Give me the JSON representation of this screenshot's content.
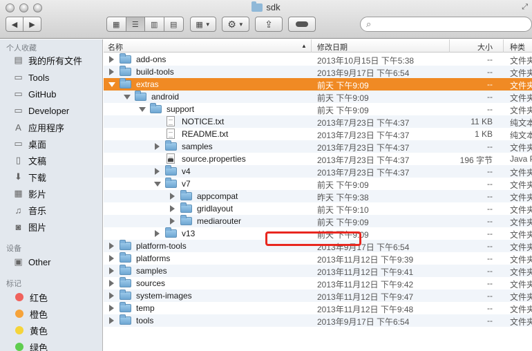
{
  "window": {
    "title": "sdk"
  },
  "sidebar": {
    "favorites_heading": "个人收藏",
    "favorites": [
      {
        "label": "我的所有文件",
        "icon": "all-files-icon"
      },
      {
        "label": "Tools",
        "icon": "folder-icon"
      },
      {
        "label": "GitHub",
        "icon": "folder-icon"
      },
      {
        "label": "Developer",
        "icon": "folder-icon"
      },
      {
        "label": "应用程序",
        "icon": "applications-icon"
      },
      {
        "label": "桌面",
        "icon": "desktop-icon"
      },
      {
        "label": "文稿",
        "icon": "documents-icon"
      },
      {
        "label": "下载",
        "icon": "downloads-icon"
      },
      {
        "label": "影片",
        "icon": "movies-icon"
      },
      {
        "label": "音乐",
        "icon": "music-icon"
      },
      {
        "label": "图片",
        "icon": "pictures-icon"
      }
    ],
    "devices_heading": "设备",
    "devices": [
      {
        "label": "Other",
        "icon": "disk-icon"
      }
    ],
    "tags_heading": "标记",
    "tags": [
      {
        "label": "红色",
        "color": "#f0625c"
      },
      {
        "label": "橙色",
        "color": "#f6a33a"
      },
      {
        "label": "黄色",
        "color": "#f5d43a"
      },
      {
        "label": "绿色",
        "color": "#5fcd4f"
      }
    ]
  },
  "columns": {
    "name": "名称",
    "date": "修改日期",
    "size": "大小",
    "kind": "种类"
  },
  "files": [
    {
      "name": "add-ons",
      "date": "2013年10月15日 下午5:38",
      "size": "--",
      "kind": "文件夹",
      "type": "folder",
      "depth": 0,
      "expanded": false
    },
    {
      "name": "build-tools",
      "date": "2013年9月17日 下午6:54",
      "size": "--",
      "kind": "文件夹",
      "type": "folder",
      "depth": 0,
      "expanded": false
    },
    {
      "name": "extras",
      "date": "前天 下午9:09",
      "size": "--",
      "kind": "文件夹",
      "type": "folder",
      "depth": 0,
      "expanded": true,
      "selected": true
    },
    {
      "name": "android",
      "date": "前天 下午9:09",
      "size": "--",
      "kind": "文件夹",
      "type": "folder",
      "depth": 1,
      "expanded": true
    },
    {
      "name": "support",
      "date": "前天 下午9:09",
      "size": "--",
      "kind": "文件夹",
      "type": "folder",
      "depth": 2,
      "expanded": true
    },
    {
      "name": "NOTICE.txt",
      "date": "2013年7月23日 下午4:37",
      "size": "11 KB",
      "kind": "纯文本",
      "type": "file",
      "depth": 3
    },
    {
      "name": "README.txt",
      "date": "2013年7月23日 下午4:37",
      "size": "1 KB",
      "kind": "纯文本",
      "type": "file",
      "depth": 3
    },
    {
      "name": "samples",
      "date": "2013年7月23日 下午4:37",
      "size": "--",
      "kind": "文件夹",
      "type": "folder",
      "depth": 3,
      "expanded": false
    },
    {
      "name": "source.properties",
      "date": "2013年7月23日 下午4:37",
      "size": "196 字节",
      "kind": "Java P",
      "type": "file-dark",
      "depth": 3
    },
    {
      "name": "v4",
      "date": "2013年7月23日 下午4:37",
      "size": "--",
      "kind": "文件夹",
      "type": "folder",
      "depth": 3,
      "expanded": false
    },
    {
      "name": "v7",
      "date": "前天 下午9:09",
      "size": "--",
      "kind": "文件夹",
      "type": "folder",
      "depth": 3,
      "expanded": true
    },
    {
      "name": "appcompat",
      "date": "昨天 下午9:38",
      "size": "--",
      "kind": "文件夹",
      "type": "folder",
      "depth": 4,
      "expanded": false,
      "highlighted": true
    },
    {
      "name": "gridlayout",
      "date": "前天 下午9:10",
      "size": "--",
      "kind": "文件夹",
      "type": "folder",
      "depth": 4,
      "expanded": false
    },
    {
      "name": "mediarouter",
      "date": "前天 下午9:09",
      "size": "--",
      "kind": "文件夹",
      "type": "folder",
      "depth": 4,
      "expanded": false
    },
    {
      "name": "v13",
      "date": "前天 下午9:09",
      "size": "--",
      "kind": "文件夹",
      "type": "folder",
      "depth": 3,
      "expanded": false
    },
    {
      "name": "platform-tools",
      "date": "2013年9月17日 下午6:54",
      "size": "--",
      "kind": "文件夹",
      "type": "folder",
      "depth": 0,
      "expanded": false
    },
    {
      "name": "platforms",
      "date": "2013年11月12日 下午9:39",
      "size": "--",
      "kind": "文件夹",
      "type": "folder",
      "depth": 0,
      "expanded": false
    },
    {
      "name": "samples",
      "date": "2013年11月12日 下午9:41",
      "size": "--",
      "kind": "文件夹",
      "type": "folder",
      "depth": 0,
      "expanded": false
    },
    {
      "name": "sources",
      "date": "2013年11月12日 下午9:42",
      "size": "--",
      "kind": "文件夹",
      "type": "folder",
      "depth": 0,
      "expanded": false
    },
    {
      "name": "system-images",
      "date": "2013年11月12日 下午9:47",
      "size": "--",
      "kind": "文件夹",
      "type": "folder",
      "depth": 0,
      "expanded": false
    },
    {
      "name": "temp",
      "date": "2013年11月12日 下午9:48",
      "size": "--",
      "kind": "文件夹",
      "type": "folder",
      "depth": 0,
      "expanded": false
    },
    {
      "name": "tools",
      "date": "2013年9月17日 下午6:54",
      "size": "--",
      "kind": "文件夹",
      "type": "folder",
      "depth": 0,
      "expanded": false
    }
  ]
}
